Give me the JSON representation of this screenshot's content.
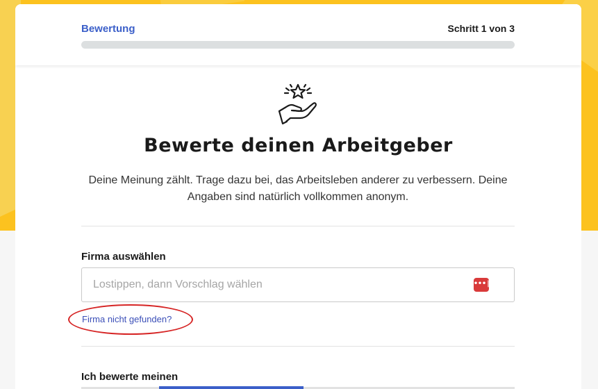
{
  "header": {
    "step_label": "Bewertung",
    "step_count": "Schritt 1 von 3",
    "progress_fraction": 0.0
  },
  "hero": {
    "icon": "hand-with-stars-icon",
    "title": "Bewerte deinen Arbeitgeber",
    "intro": "Deine Meinung zählt. Trage dazu bei, das Arbeitsleben anderer zu verbessern. Deine Angaben sind natürlich vollkommen anonym."
  },
  "company": {
    "label": "Firma auswählen",
    "input_value": "",
    "placeholder": "Lostippen, dann Vorschlag wählen",
    "autofill_icon": "password-manager-icon",
    "autofill_glyph": "•••|",
    "not_found_link": "Firma nicht gefunden?"
  },
  "rating_target": {
    "label": "Ich bewerte meinen"
  },
  "colors": {
    "accent": "#3b5fc9",
    "background": "#fcc21f",
    "annotation": "#d62424",
    "autofill_icon": "#d93a3a"
  }
}
